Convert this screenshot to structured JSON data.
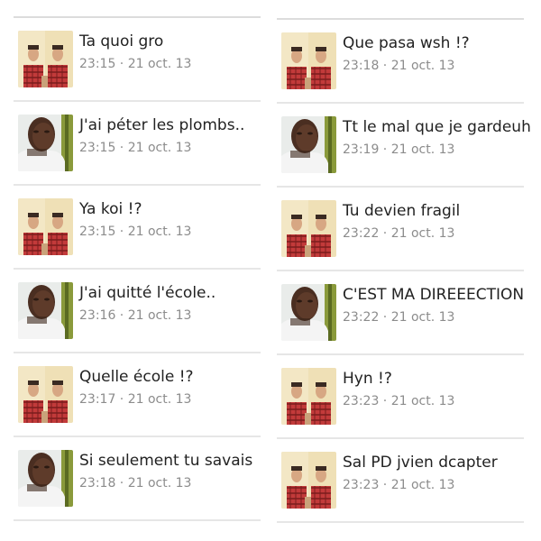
{
  "left_column": {
    "messages": [
      {
        "sender": "friend",
        "text": "Ta quoi gro",
        "time": "23:15 · 21 oct. 13"
      },
      {
        "sender": "user",
        "text": "J'ai péter les plombs..",
        "time": "23:15 · 21 oct. 13"
      },
      {
        "sender": "friend",
        "text": "Ya koi !?",
        "time": "23:15 · 21 oct. 13"
      },
      {
        "sender": "user",
        "text": "J'ai quitté l'école..",
        "time": "23:16 · 21 oct. 13"
      },
      {
        "sender": "friend",
        "text": "Quelle école !?",
        "time": "23:17 · 21 oct. 13"
      },
      {
        "sender": "user",
        "text": "Si seulement tu savais",
        "time": "23:18 · 21 oct. 13"
      }
    ]
  },
  "right_column": {
    "messages": [
      {
        "sender": "friend",
        "text": "Que pasa wsh !?",
        "time": "23:18 · 21 oct. 13"
      },
      {
        "sender": "user",
        "text": "Tt le mal que je gardeuh",
        "time": "23:19 · 21 oct. 13"
      },
      {
        "sender": "friend",
        "text": "Tu devien fragil",
        "time": "23:22 · 21 oct. 13"
      },
      {
        "sender": "user",
        "text": "C'EST MA DIREEECTION",
        "time": "23:22 · 21 oct. 13"
      },
      {
        "sender": "friend",
        "text": "Hyn !?",
        "time": "23:23 · 21 oct. 13"
      },
      {
        "sender": "friend",
        "text": "Sal PD jvien dcapter",
        "time": "23:23 · 21 oct. 13"
      }
    ]
  },
  "colors": {
    "text": "#222222",
    "timestamp": "#8c8c8c",
    "divider": "#e6e6e6"
  }
}
